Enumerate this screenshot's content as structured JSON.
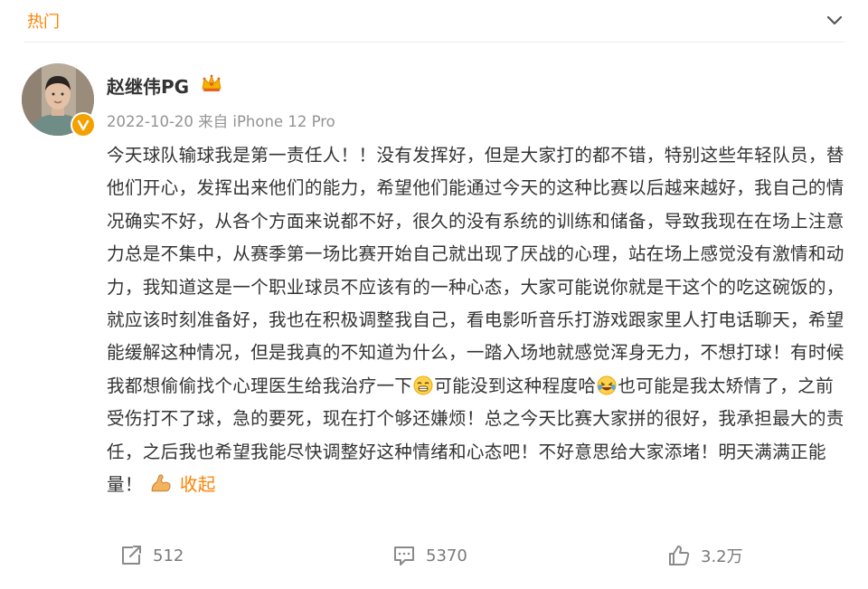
{
  "header": {
    "tab_label": "热门"
  },
  "post": {
    "author": "赵继伟PG",
    "date": "2022-10-20",
    "source": "来自 iPhone 12 Pro",
    "text_part1": "今天球队输球我是第一责任人！！没有发挥好，但是大家打的都不错，特别这些年轻队员，替他们开心，发挥出来他们的能力，希望他们能通过今天的这种比赛以后越来越好，我自己的情况确实不好，从各个方面来说都不好，很久的没有系统的训练和储备，导致我现在在场上注意力总是不集中，从赛季第一场比赛开始自己就出现了厌战的心理，站在场上感觉没有激情和动力，我知道这是一个职业球员不应该有的一种心态，大家可能说你就是干这个的吃这碗饭的，就应该时刻准备好，我也在积极调整我自己，看电影听音乐打游戏跟家里人打电话聊天，希望能缓解这种情况，但是我真的不知道为什么，一踏入场地就感觉浑身无力，不想打球！有时候我都想偷偷找个心理医生给我治疗一下",
    "text_part2": "可能没到这种程度哈",
    "text_part3": "也可能是我太矫情了，之前受伤打不了球，急的要死，现在打个够还嫌烦！总之今天比赛大家拼的很好，我承担最大的责任，之后我也希望我能尽快调整好这种情绪和心态吧！不好意思给大家添堵！明天满满正能量！",
    "collapse_label": "收起"
  },
  "actions": {
    "repost_count": "512",
    "comment_count": "5370",
    "like_count": "3.2万"
  },
  "icons": [
    "chevron-down-icon",
    "verified-badge-icon",
    "crown-icon",
    "grin-emoji-icon",
    "laugh-tears-emoji-icon",
    "flex-arm-emoji-icon",
    "repost-icon",
    "comment-icon",
    "like-icon"
  ],
  "colors": {
    "accent": "#ff8200",
    "muted": "#939393",
    "text": "#333333"
  }
}
